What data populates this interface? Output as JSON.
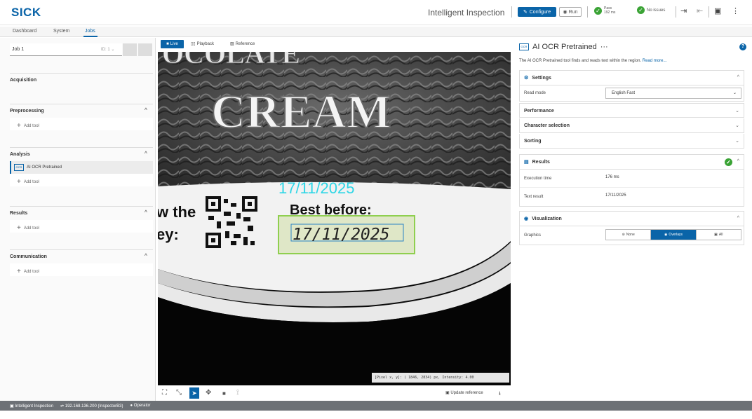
{
  "header": {
    "logo": "SICK",
    "app_title": "Intelligent Inspection",
    "configure_label": "Configure",
    "run_label": "Run",
    "pass_label": "Pass",
    "pass_time": "192 ms",
    "issues_label": "No issues"
  },
  "tabs": [
    {
      "label": "Dashboard"
    },
    {
      "label": "System"
    },
    {
      "label": "Jobs"
    }
  ],
  "left": {
    "job_name": "Job 1",
    "job_id": "ID: 1",
    "acquisition": "Acquisition",
    "preprocessing": "Preprocessing",
    "analysis": "Analysis",
    "results": "Results",
    "communication": "Communication",
    "add_tool": "Add tool",
    "analysis_tool": "AI OCR Pretrained"
  },
  "center": {
    "tab_live": "Live",
    "tab_playback": "Playback",
    "tab_reference": "Reference",
    "image_text_cream": "CREAM",
    "image_date_overlay": "17/11/2025",
    "image_best_before": "Best before:",
    "image_date_printed": "17/11/2025",
    "image_text_left1": "w the",
    "image_text_left2": "ey:",
    "pixel_readout": "[Pixel x, y]: ( 1846, 2834) px, Intensity:     4.00",
    "update_reference": "Update reference"
  },
  "right": {
    "title": "AI OCR Pretrained",
    "title_more": "···",
    "description": "The AI OCR Pretrained tool finds and reads text within the region.",
    "read_more": "Read more...",
    "settings_label": "Settings",
    "read_mode_label": "Read mode",
    "read_mode_value": "English Fast",
    "performance_label": "Performance",
    "character_selection_label": "Character selection",
    "sorting_label": "Sorting",
    "results_label": "Results",
    "execution_time_label": "Execution time",
    "execution_time_value": "176 ms",
    "text_result_label": "Text result",
    "text_result_value": "17/11/2025",
    "visualization_label": "Visualization",
    "graphics_label": "Graphics",
    "graphics_none": "None",
    "graphics_overlays": "Overlays",
    "graphics_all": "All"
  },
  "statusbar": {
    "app": "Intelligent Inspection",
    "connection": "192.168.136.200 (InspectorB3)",
    "user": "Operator"
  },
  "colors": {
    "accent": "#0a64a8",
    "pass": "#3aa335",
    "overlay_cyan": "#2fd6e6",
    "roi_green": "#8fcf4f"
  }
}
